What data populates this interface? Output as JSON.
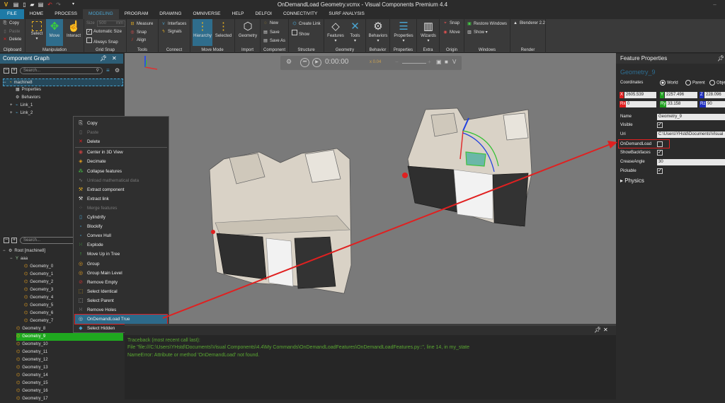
{
  "window": {
    "title": "OnDemandLoad Geometry.vcmx - Visual Components Premium 4.4",
    "minimize_icon": "minimize-icon"
  },
  "tabs": [
    "FILE",
    "HOME",
    "PROCESS",
    "MODELING",
    "PROGRAM",
    "DRAWING",
    "OMNIVERSE",
    "HELP",
    "DELFOI",
    "CONNECTIVITY",
    "SURF ANALYSIS"
  ],
  "active_tab": "MODELING",
  "ribbon": {
    "clipboard": {
      "copy": "Copy",
      "paste": "Paste",
      "delete": "Delete",
      "label": "Clipboard"
    },
    "manipulation": {
      "select": "Select",
      "move": "Move",
      "interact": "Interact",
      "label": "Manipulation"
    },
    "grid_snap": {
      "size_label": "Size",
      "size_value": "500",
      "size_unit": "mm",
      "automatic_size": "Automatic Size",
      "always_snap": "Always Snap",
      "label": "Grid Snap",
      "automatic_size_checked": true,
      "always_snap_checked": false
    },
    "tools": {
      "measure": "Measure",
      "snap": "Snap",
      "align": "Align",
      "label": "Tools"
    },
    "connect": {
      "interfaces": "Interfaces",
      "signals": "Signals",
      "label": "Connect"
    },
    "move_mode": {
      "hierarchy": "Hierarchy",
      "selected": "Selected",
      "label": "Move Mode"
    },
    "import": {
      "geometry": "Geometry",
      "label": "Import"
    },
    "component": {
      "new": "New",
      "save": "Save",
      "save_as": "Save As",
      "label": "Component"
    },
    "structure": {
      "create_link": "Create Link",
      "show": "Show",
      "label": "Structure"
    },
    "geometry": {
      "features": "Features",
      "tools": "Tools",
      "label": "Geometry"
    },
    "behavior": {
      "behaviors": "Behaviors",
      "label": "Behavior"
    },
    "properties": {
      "properties": "Properties",
      "label": "Properties"
    },
    "extra": {
      "wizards": "Wizards",
      "label": "Extra"
    },
    "origin": {
      "snap": "Snap",
      "move": "Move",
      "label": "Origin"
    },
    "windows": {
      "restore": "Restore Windows",
      "show": "Show ▾",
      "label": "Windows"
    },
    "render": {
      "blenderer": "Blenderer 2.2",
      "label": "Render"
    }
  },
  "component_graph": {
    "title": "Component Graph",
    "search_placeholder": "Search...",
    "items": [
      {
        "label": "machine8",
        "level": 0,
        "selected": true
      },
      {
        "label": "Properties",
        "level": 1
      },
      {
        "label": "Behaviors",
        "level": 1
      },
      {
        "label": "Link_1",
        "level": 1
      },
      {
        "label": "Link_2",
        "level": 1
      }
    ]
  },
  "feature_tree": {
    "search_placeholder": "Search...",
    "root": "Root [machine8]",
    "group": "aaa",
    "group_children": [
      "Geometry_0",
      "Geometry_1",
      "Geometry_2",
      "Geometry_3",
      "Geometry_4",
      "Geometry_5",
      "Geometry_6",
      "Geometry_7"
    ],
    "children": [
      "Geometry_8",
      "Geometry_9",
      "Geometry_10",
      "Geometry_11",
      "Geometry_12",
      "Geometry_13",
      "Geometry_14",
      "Geometry_15",
      "Geometry_16",
      "Geometry_17"
    ],
    "selected": "Geometry_9"
  },
  "context_menu": {
    "items": [
      {
        "label": "Copy",
        "enabled": true,
        "icon": "copy-icon"
      },
      {
        "label": "Paste",
        "enabled": false,
        "icon": "paste-icon"
      },
      {
        "label": "Delete",
        "enabled": true,
        "icon": "delete-icon"
      },
      {
        "label": "Center in 3D View",
        "enabled": true,
        "icon": "center-icon"
      },
      {
        "label": "Decimate",
        "enabled": true,
        "icon": "decimate-icon"
      },
      {
        "label": "Collapse features",
        "enabled": true,
        "icon": "collapse-icon"
      },
      {
        "label": "Unload mathematical data",
        "enabled": false,
        "icon": "unload-icon"
      },
      {
        "label": "Extract component",
        "enabled": true,
        "icon": "extract-component-icon"
      },
      {
        "label": "Extract link",
        "enabled": true,
        "icon": "extract-link-icon"
      },
      {
        "label": "Merge features",
        "enabled": false,
        "icon": "merge-icon"
      },
      {
        "label": "Cylindrify",
        "enabled": true,
        "icon": "cylindrify-icon"
      },
      {
        "label": "Blockify",
        "enabled": true,
        "icon": "blockify-icon"
      },
      {
        "label": "Convex Hull",
        "enabled": true,
        "icon": "convex-hull-icon"
      },
      {
        "label": "Explode",
        "enabled": true,
        "icon": "explode-icon"
      },
      {
        "label": "Move Up in Tree",
        "enabled": true,
        "icon": "move-up-icon"
      },
      {
        "label": "Group",
        "enabled": true,
        "icon": "group-icon"
      },
      {
        "label": "Group Main Level",
        "enabled": true,
        "icon": "group-main-icon"
      },
      {
        "label": "Remove Empty",
        "enabled": true,
        "icon": "remove-empty-icon"
      },
      {
        "label": "Select Identical",
        "enabled": true,
        "icon": "select-identical-icon"
      },
      {
        "label": "Select Parent",
        "enabled": true,
        "icon": "select-parent-icon"
      },
      {
        "label": "Remove Holes",
        "enabled": true,
        "icon": "remove-holes-icon"
      },
      {
        "label": "OnDemandLoad True",
        "enabled": true,
        "highlighted": true,
        "icon": "ondemandload-icon"
      },
      {
        "label": "Select Hidden",
        "enabled": true,
        "icon": "select-hidden-icon"
      }
    ]
  },
  "playback": {
    "time": "0:00:00",
    "speed": "x 0.04"
  },
  "feature_properties": {
    "title": "Feature Properties",
    "name_header": "Geometry_9",
    "coordinates_label": "Coordinates",
    "coord_options": [
      "World",
      "Parent",
      "Object"
    ],
    "coord_selected": "World",
    "x": "2605.539",
    "y": "2257.496",
    "z": "228.096",
    "rx": "0",
    "ry": "33.158",
    "rz": "90",
    "props": {
      "name_label": "Name",
      "name": "Geometry_9",
      "visible_label": "Visible",
      "visible": true,
      "uri_label": "Uri",
      "uri": "C:\\Users\\YHstd\\Documents\\Visual",
      "ondemandload_label": "OnDemandLoad",
      "ondemandload": false,
      "showbackfaces_label": "ShowBackfaces",
      "showbackfaces": true,
      "creaseangle_label": "CreaseAngle",
      "creaseangle": "30",
      "pickable_label": "Pickable",
      "pickable": true
    },
    "physics": "Physics"
  },
  "output": {
    "lines": [
      "Traceback (most recent call last):",
      "  File \"file:///C:\\Users\\YHstd\\Documents\\Visual Components\\4.4\\My Commands\\OnDemandLoadFeatures\\OnDemandLoadFeatures.py::\", line 14, in my_state",
      "NameError: Attribute or method 'OnDemandLoad' not found."
    ]
  },
  "colors": {
    "accent": "#1e7aa6",
    "selection": "#2d6a8a",
    "tree_selected": "#1fa81f",
    "annotation": "#e02020",
    "error_text": "#5aa832"
  }
}
